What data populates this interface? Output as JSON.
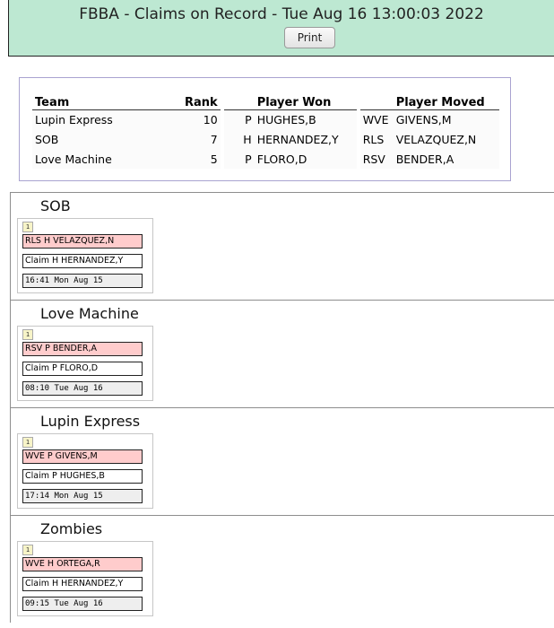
{
  "header": {
    "title": "FBBA - Claims on Record - Tue Aug 16 13:00:03 2022",
    "print_label": "Print"
  },
  "summary": {
    "headers": {
      "team": "Team",
      "rank": "Rank",
      "player_won": "Player Won",
      "player_moved": "Player Moved"
    },
    "rows": [
      {
        "team": "Lupin Express",
        "rank": "10",
        "pos": "P",
        "player_won": "HUGHES,B",
        "action": "WVE",
        "player_moved": "GIVENS,M"
      },
      {
        "team": "SOB",
        "rank": "7",
        "pos": "H",
        "player_won": "HERNANDEZ,Y",
        "action": "RLS",
        "player_moved": "VELAZQUEZ,N"
      },
      {
        "team": "Love Machine",
        "rank": "5",
        "pos": "P",
        "player_won": "FLORO,D",
        "action": "RSV",
        "player_moved": "BENDER,A"
      }
    ]
  },
  "teams": [
    {
      "name": "SOB",
      "claims": [
        {
          "num": "1",
          "move": "RLS H VELAZQUEZ,N",
          "claim": "Claim H HERNANDEZ,Y",
          "time": "16:41 Mon Aug 15"
        }
      ]
    },
    {
      "name": "Love Machine",
      "claims": [
        {
          "num": "1",
          "move": "RSV P BENDER,A",
          "claim": "Claim P FLORO,D",
          "time": "08:10 Tue Aug 16"
        }
      ]
    },
    {
      "name": "Lupin Express",
      "claims": [
        {
          "num": "1",
          "move": "WVE P GIVENS,M",
          "claim": "Claim P HUGHES,B",
          "time": "17:14 Mon Aug 15"
        }
      ]
    },
    {
      "name": "Zombies",
      "claims": [
        {
          "num": "1",
          "move": "WVE H ORTEGA,R",
          "claim": "Claim H HERNANDEZ,Y",
          "time": "09:15 Tue Aug 16"
        }
      ]
    }
  ]
}
